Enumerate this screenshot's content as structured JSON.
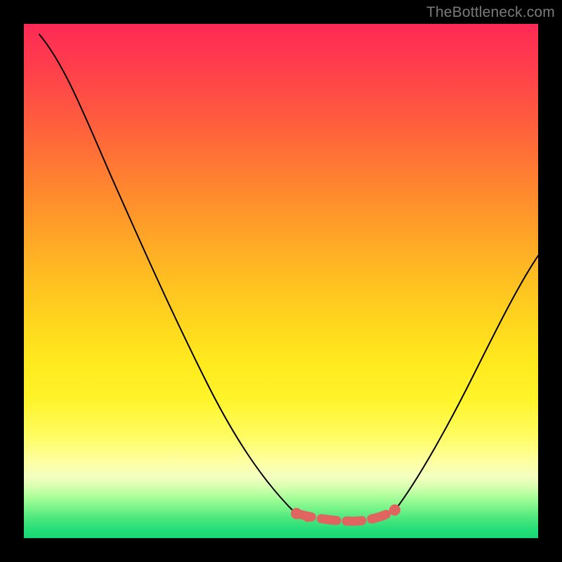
{
  "watermark": "TheBottleneck.com",
  "colors": {
    "frame": "#000000",
    "curve": "#000000",
    "flat_marker": "#e0645f",
    "gradient_top": "#ff2a55",
    "gradient_mid": "#ffd61e",
    "gradient_bottom": "#15d873"
  },
  "chart_data": {
    "type": "line",
    "title": "",
    "xlabel": "",
    "ylabel": "",
    "xlim": [
      0,
      100
    ],
    "ylim": [
      0,
      100
    ],
    "series": [
      {
        "name": "left-curve",
        "x": [
          3,
          8,
          14,
          20,
          26,
          32,
          38,
          44,
          50,
          53
        ],
        "values": [
          98,
          90,
          80,
          69,
          58,
          46,
          34,
          22,
          10,
          5
        ]
      },
      {
        "name": "flat-bottleneck-zone",
        "x": [
          53,
          57,
          61,
          65,
          69,
          72
        ],
        "values": [
          5,
          4,
          4,
          4,
          5,
          6
        ]
      },
      {
        "name": "right-curve",
        "x": [
          72,
          78,
          84,
          90,
          96,
          100
        ],
        "values": [
          6,
          15,
          25,
          36,
          47,
          55
        ]
      }
    ],
    "annotations": [
      {
        "text": "TheBottleneck.com",
        "position": "top-right"
      }
    ]
  }
}
